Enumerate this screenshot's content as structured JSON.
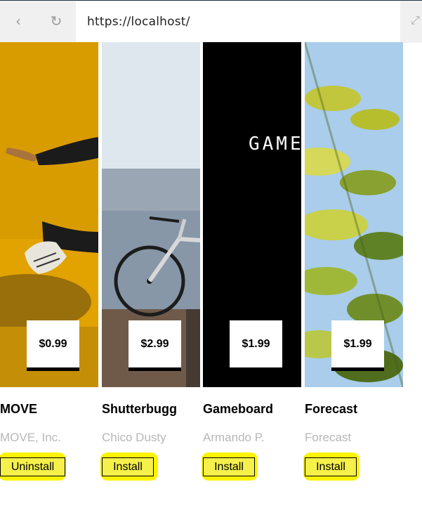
{
  "browser": {
    "back_glyph": "‹",
    "reload_glyph": "↻",
    "url": "https://localhost/",
    "expand_glyph": "⤢"
  },
  "apps": [
    {
      "title": "MOVE",
      "author": "MOVE, Inc.",
      "price": "$0.99",
      "action": "Uninstall"
    },
    {
      "title": "Shutterbugg",
      "author": "Chico Dusty",
      "price": "$2.99",
      "action": "Install"
    },
    {
      "title": "Gameboard",
      "author": "Armando P.",
      "price": "$1.99",
      "action": "Install",
      "hero_text": "GAME"
    },
    {
      "title": "Forecast",
      "author": "Forecast",
      "price": "$1.99",
      "action": "Install"
    }
  ],
  "colors": {
    "highlight": "#fbf300",
    "move_bg": "#e2a200",
    "game_bg": "#000000",
    "author_text": "#b7b7b7"
  }
}
